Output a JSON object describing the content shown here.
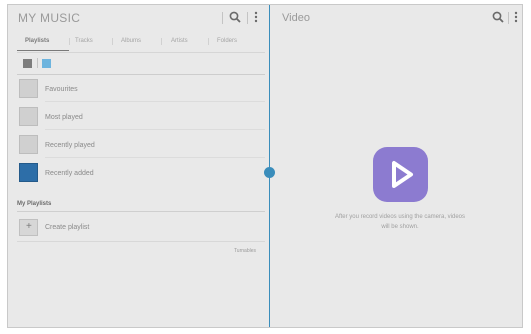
{
  "music": {
    "title": "MY MUSIC",
    "tabs": [
      {
        "label": "Playlists",
        "active": true
      },
      {
        "label": "Tracks",
        "active": false
      },
      {
        "label": "Albums",
        "active": false
      },
      {
        "label": "Artists",
        "active": false
      },
      {
        "label": "Folders",
        "active": false
      }
    ],
    "view_toggle": {
      "selected": "list-view"
    },
    "playlists": [
      {
        "label": "Favourites",
        "thumb": "placeholder"
      },
      {
        "label": "Most played",
        "thumb": "placeholder"
      },
      {
        "label": "Recently played",
        "thumb": "placeholder"
      },
      {
        "label": "Recently added",
        "thumb": "album-art"
      }
    ],
    "my_playlists_header": "My Playlists",
    "create_playlist_label": "Create playlist",
    "footer_link": "Turnables"
  },
  "video": {
    "title": "Video",
    "empty_message": "After you record videos using the camera, videos will be shown."
  },
  "colors": {
    "accent": "#3a8dbb",
    "video_icon": "#8c7bd0",
    "album_art": "#2d6ea8",
    "background": "#e9e9e9"
  },
  "icons": {
    "search": "search-icon",
    "more": "more-vert-icon",
    "grid": "grid-view-icon",
    "list": "list-view-icon",
    "play": "play-icon",
    "add": "plus-icon"
  }
}
